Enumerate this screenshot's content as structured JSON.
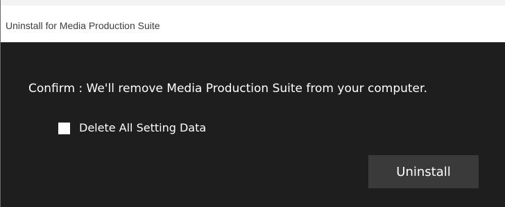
{
  "window": {
    "title": "Uninstall for Media Production Suite"
  },
  "dialog": {
    "message": "Confirm : We'll remove Media Production Suite from your computer.",
    "delete_setting_label": "Delete All Setting Data",
    "delete_setting_checked": false,
    "uninstall_label": "Uninstall"
  },
  "colors": {
    "background": "#1e1e1e",
    "button": "#3a3a3a",
    "text": "#ffffff"
  }
}
